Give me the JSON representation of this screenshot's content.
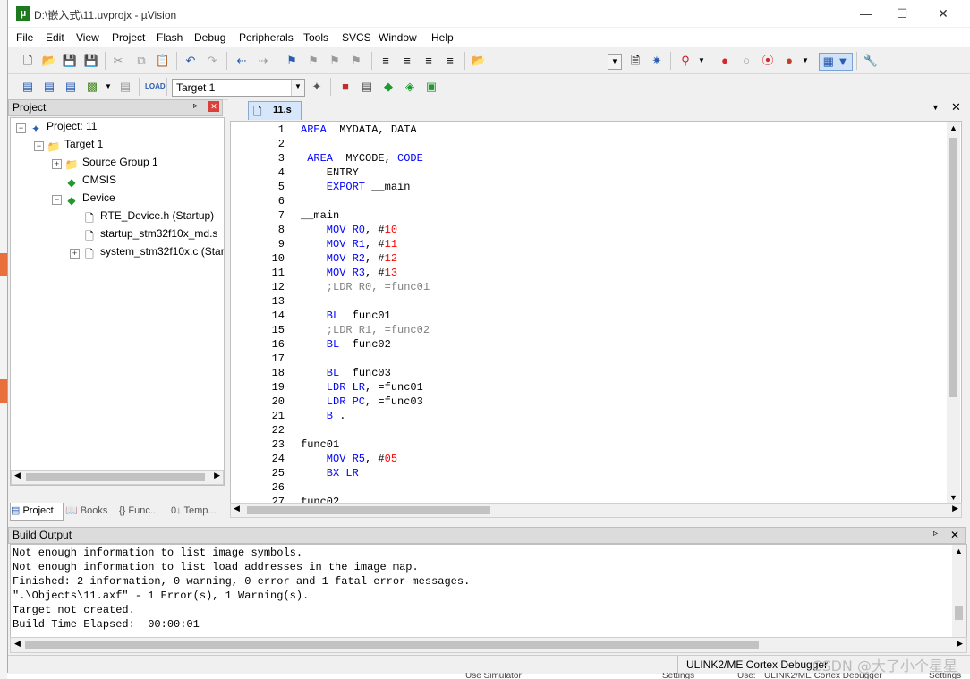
{
  "window": {
    "title": "D:\\嵌入式\\11.uvprojx - µVision",
    "app_icon": "µ"
  },
  "menubar": {
    "items": [
      "File",
      "Edit",
      "View",
      "Project",
      "Flash",
      "Debug",
      "Peripherals",
      "Tools",
      "SVCS",
      "Window",
      "Help"
    ]
  },
  "toolbar2": {
    "target_combo": "Target 1"
  },
  "project_panel": {
    "title": "Project",
    "tree": [
      {
        "label": "Project: 11",
        "level": 0,
        "icon": "project-icon",
        "expander": "−"
      },
      {
        "label": "Target 1",
        "level": 1,
        "icon": "target-folder-icon",
        "expander": "−"
      },
      {
        "label": "Source Group 1",
        "level": 2,
        "icon": "folder-icon",
        "expander": "+"
      },
      {
        "label": "CMSIS",
        "level": 2,
        "icon": "component-diamond-icon",
        "expander": ""
      },
      {
        "label": "Device",
        "level": 2,
        "icon": "component-diamond-icon",
        "expander": "−"
      },
      {
        "label": "RTE_Device.h (Startup)",
        "level": 3,
        "icon": "file-icon",
        "expander": ""
      },
      {
        "label": "startup_stm32f10x_md.s",
        "level": 3,
        "icon": "file-icon",
        "expander": ""
      },
      {
        "label": "system_stm32f10x.c (Startup)",
        "level": 3,
        "icon": "file-icon",
        "expander": "+"
      }
    ],
    "tabs": [
      "Project",
      "Books",
      "{} Func...",
      "0↓ Temp..."
    ]
  },
  "editor": {
    "tab_label": "11.s",
    "lines": [
      {
        "n": "1",
        "tokens": [
          [
            "kw",
            "AREA"
          ],
          [
            "",
            "  MYDATA, DATA"
          ]
        ]
      },
      {
        "n": "2",
        "tokens": []
      },
      {
        "n": "3",
        "tokens": [
          [
            "kw",
            " AREA"
          ],
          [
            "",
            "  MYCODE, "
          ],
          [
            "kw",
            "CODE"
          ]
        ]
      },
      {
        "n": "4",
        "tokens": [
          [
            "",
            "    ENTRY"
          ]
        ]
      },
      {
        "n": "5",
        "tokens": [
          [
            "kw",
            "    EXPORT"
          ],
          [
            "",
            " __main"
          ]
        ]
      },
      {
        "n": "6",
        "tokens": []
      },
      {
        "n": "7",
        "tokens": [
          [
            "",
            "__main"
          ]
        ]
      },
      {
        "n": "8",
        "tokens": [
          [
            "kw",
            "    MOV R0"
          ],
          [
            "",
            ", #"
          ],
          [
            "num",
            "10"
          ]
        ]
      },
      {
        "n": "9",
        "tokens": [
          [
            "kw",
            "    MOV R1"
          ],
          [
            "",
            ", #"
          ],
          [
            "num",
            "11"
          ]
        ]
      },
      {
        "n": "10",
        "tokens": [
          [
            "kw",
            "    MOV R2"
          ],
          [
            "",
            ", #"
          ],
          [
            "num",
            "12"
          ]
        ]
      },
      {
        "n": "11",
        "tokens": [
          [
            "kw",
            "    MOV R3"
          ],
          [
            "",
            ", #"
          ],
          [
            "num",
            "13"
          ]
        ]
      },
      {
        "n": "12",
        "tokens": [
          [
            "cmt",
            "    ;LDR R0, =func01"
          ]
        ]
      },
      {
        "n": "13",
        "tokens": []
      },
      {
        "n": "14",
        "tokens": [
          [
            "kw",
            "    BL"
          ],
          [
            "",
            "  func01"
          ]
        ]
      },
      {
        "n": "15",
        "tokens": [
          [
            "cmt",
            "    ;LDR R1, =func02"
          ]
        ]
      },
      {
        "n": "16",
        "tokens": [
          [
            "kw",
            "    BL"
          ],
          [
            "",
            "  func02"
          ]
        ]
      },
      {
        "n": "17",
        "tokens": []
      },
      {
        "n": "18",
        "tokens": [
          [
            "kw",
            "    BL"
          ],
          [
            "",
            "  func03"
          ]
        ]
      },
      {
        "n": "19",
        "tokens": [
          [
            "kw",
            "    LDR LR"
          ],
          [
            "",
            ", =func01"
          ]
        ]
      },
      {
        "n": "20",
        "tokens": [
          [
            "kw",
            "    LDR PC"
          ],
          [
            "",
            ", =func03"
          ]
        ]
      },
      {
        "n": "21",
        "tokens": [
          [
            "kw",
            "    B"
          ],
          [
            "",
            " ."
          ]
        ]
      },
      {
        "n": "22",
        "tokens": []
      },
      {
        "n": "23",
        "tokens": [
          [
            "",
            "func01"
          ]
        ]
      },
      {
        "n": "24",
        "tokens": [
          [
            "kw",
            "    MOV R5"
          ],
          [
            "",
            ", #"
          ],
          [
            "num",
            "05"
          ]
        ]
      },
      {
        "n": "25",
        "tokens": [
          [
            "kw",
            "    BX LR"
          ]
        ]
      },
      {
        "n": "26",
        "tokens": []
      },
      {
        "n": "27",
        "tokens": [
          [
            "",
            "func02"
          ]
        ]
      }
    ]
  },
  "build_output": {
    "title": "Build Output",
    "lines": [
      "Not enough information to list image symbols.",
      "Not enough information to list load addresses in the image map.",
      "Finished: 2 information, 0 warning, 0 error and 1 fatal error messages.",
      "\".\\Objects\\11.axf\" - 1 Error(s), 1 Warning(s).",
      "Target not created.",
      "Build Time Elapsed:  00:00:01"
    ]
  },
  "statusbar": {
    "debugger": "ULINK2/ME Cortex Debugger"
  },
  "background": {
    "fragments": [
      "Use Simulator",
      "Settings",
      "Use:",
      "ULINK2/ME Cortex Debugger",
      "Settings"
    ]
  },
  "watermark": "CSDN @大了小个星星"
}
